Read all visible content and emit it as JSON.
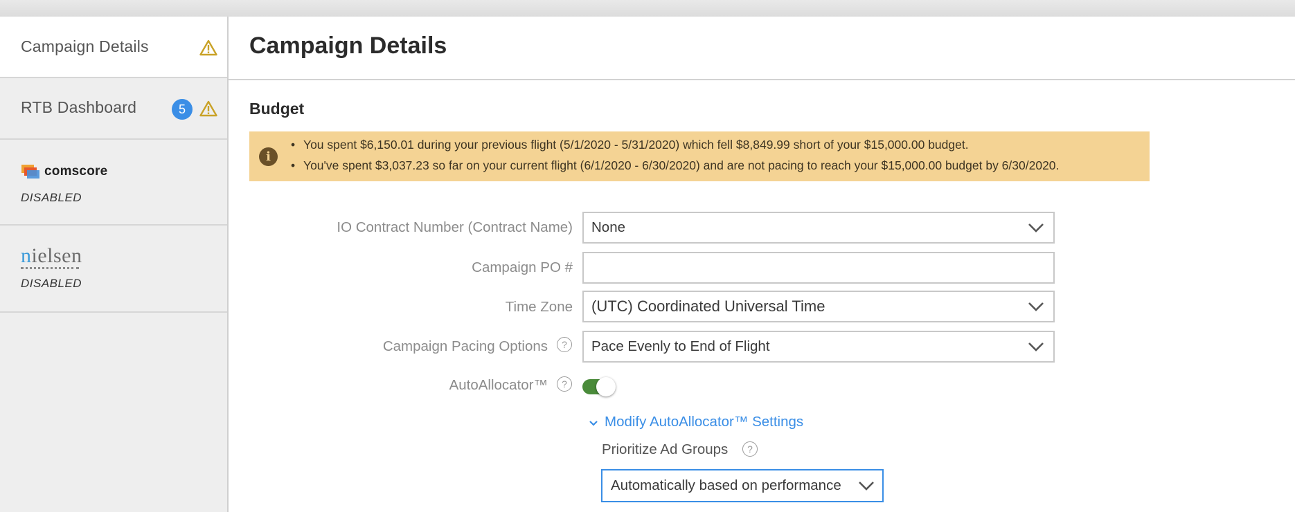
{
  "sidebar": {
    "items": [
      {
        "label": "Campaign Details",
        "icon": "warning-icon"
      },
      {
        "label": "RTB Dashboard",
        "badge": "5",
        "icon": "warning-icon"
      }
    ],
    "integrations": [
      {
        "brand": "comscore",
        "status": "DISABLED"
      },
      {
        "brand_prefix": "n",
        "brand_rest": "ielsen",
        "status": "DISABLED"
      }
    ]
  },
  "main": {
    "title": "Campaign Details",
    "section": "Budget",
    "alert": {
      "icon": "info-icon",
      "lines": [
        "You spent $6,150.01 during your previous flight (5/1/2020 - 5/31/2020) which fell $8,849.99 short of your $15,000.00 budget.",
        "You've spent $3,037.23 so far on your current flight (6/1/2020 - 6/30/2020) and are not pacing to reach your $15,000.00 budget by 6/30/2020."
      ]
    },
    "form": {
      "io_contract": {
        "label": "IO Contract Number (Contract Name)",
        "value": "None"
      },
      "campaign_po": {
        "label": "Campaign PO #",
        "value": ""
      },
      "time_zone": {
        "label": "Time Zone",
        "value": "(UTC) Coordinated Universal Time"
      },
      "pacing": {
        "label": "Campaign Pacing Options",
        "value": "Pace Evenly to End of Flight"
      },
      "autoallocator": {
        "label": "AutoAllocator™",
        "enabled": true
      },
      "modify_link": "Modify AutoAllocator™ Settings",
      "prioritize": {
        "label": "Prioritize Ad Groups",
        "value": "Automatically based on performance"
      }
    }
  },
  "colors": {
    "accent": "#3a8ee6",
    "warning": "#c9a227",
    "alert_bg": "#f4d394",
    "toggle_on": "#4a8b3a"
  }
}
